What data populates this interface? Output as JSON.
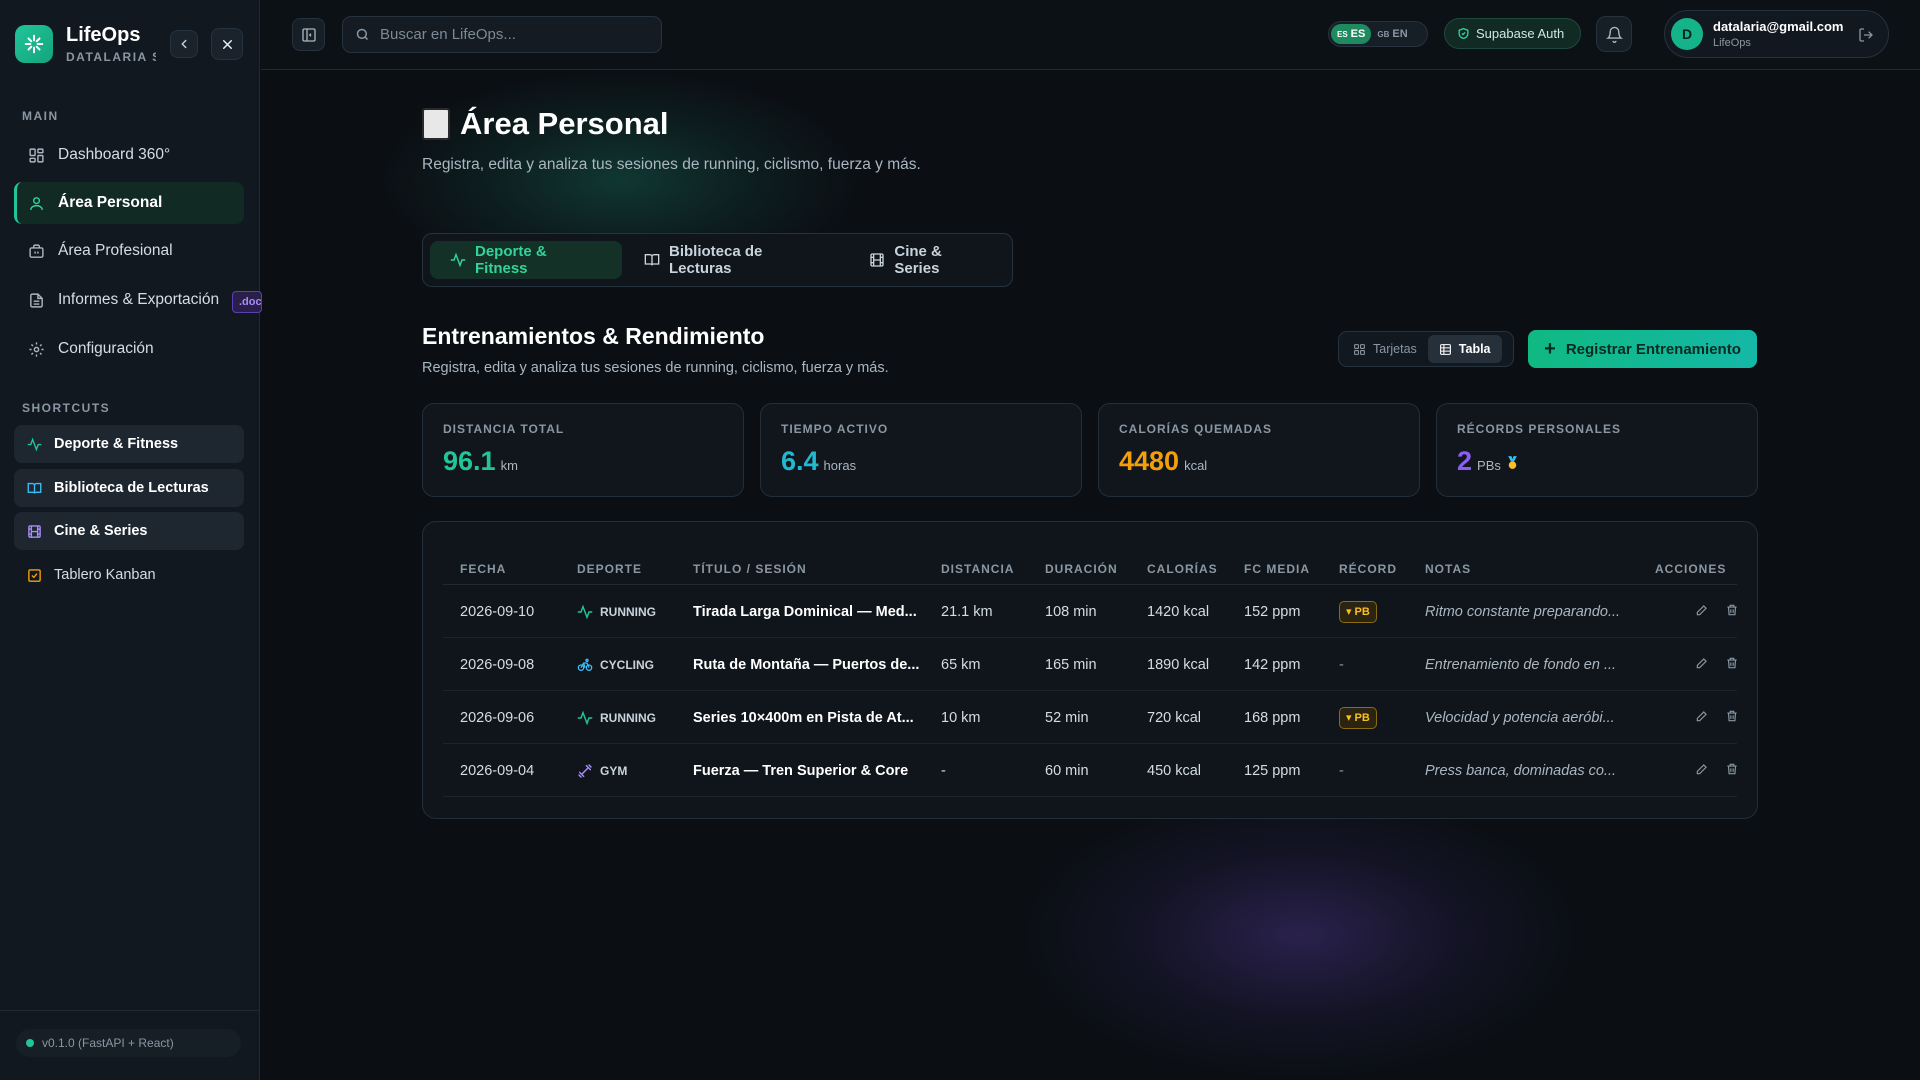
{
  "app": {
    "name": "LifeOps",
    "subtitle": "DATALARIA STUDIO"
  },
  "sidebar": {
    "main_label": "MAIN",
    "items": [
      {
        "label": "Dashboard 360°",
        "icon": "dashboard-icon"
      },
      {
        "label": "Área Personal",
        "icon": "user-icon",
        "active": true
      },
      {
        "label": "Área Profesional",
        "icon": "briefcase-icon"
      },
      {
        "label": "Informes & Exportación",
        "icon": "file-icon",
        "badge": ".docx"
      },
      {
        "label": "Configuración",
        "icon": "gear-icon"
      }
    ],
    "shortcuts_label": "SHORTCUTS",
    "shortcuts": [
      {
        "label": "Deporte & Fitness",
        "icon": "activity-icon"
      },
      {
        "label": "Biblioteca de Lecturas",
        "icon": "book-icon"
      },
      {
        "label": "Cine & Series",
        "icon": "film-icon"
      },
      {
        "label": "Tablero Kanban",
        "icon": "checkbox-icon"
      }
    ],
    "version": "v0.1.0 (FastAPI + React)"
  },
  "topbar": {
    "search_placeholder": "Buscar en LifeOps...",
    "lang_es_flag": "ES",
    "lang_es": "ES",
    "lang_en_flag": "GB",
    "lang_en": "EN",
    "auth_label": "Supabase Auth",
    "user_initial": "D",
    "user_email": "datalaria@gmail.com",
    "user_app": "LifeOps"
  },
  "page": {
    "title": "Área Personal",
    "subtitle": "Registra, edita y analiza tus sesiones de running, ciclismo, fuerza y más."
  },
  "tabs": [
    {
      "label": "Deporte & Fitness",
      "active": true
    },
    {
      "label": "Biblioteca de Lecturas"
    },
    {
      "label": "Cine & Series"
    }
  ],
  "section": {
    "title": "Entrenamientos & Rendimiento",
    "subtitle": "Registra, edita y analiza tus sesiones de running, ciclismo, fuerza y más.",
    "view_cards": "Tarjetas",
    "view_table": "Tabla",
    "add_button": "Registrar Entrenamiento"
  },
  "stats": [
    {
      "label": "DISTANCIA TOTAL",
      "value": "96.1",
      "unit": "km",
      "color": "#22c59a"
    },
    {
      "label": "TIEMPO ACTIVO",
      "value": "6.4",
      "unit": "horas",
      "color": "#22b8cf"
    },
    {
      "label": "CALORÍAS QUEMADAS",
      "value": "4480",
      "unit": "kcal",
      "color": "#f59e0b"
    },
    {
      "label": "RÉCORDS PERSONALES",
      "value": "2",
      "unit": "PBs",
      "color": "#8b5cf6"
    }
  ],
  "table": {
    "headers": [
      "FECHA",
      "DEPORTE",
      "TÍTULO / SESIÓN",
      "DISTANCIA",
      "DURACIÓN",
      "CALORÍAS",
      "FC MEDIA",
      "RÉCORD",
      "NOTAS",
      "ACCIONES"
    ],
    "rows": [
      {
        "date": "2026-09-10",
        "sport": "RUNNING",
        "title": "Tirada Larga Dominical — Med...",
        "distance": "21.1 km",
        "duration": "108 min",
        "calories": "1420 kcal",
        "hr": "152 ppm",
        "record": "PB",
        "notes": "Ritmo constante preparando..."
      },
      {
        "date": "2026-09-08",
        "sport": "CYCLING",
        "title": "Ruta de Montaña — Puertos de...",
        "distance": "65 km",
        "duration": "165 min",
        "calories": "1890 kcal",
        "hr": "142 ppm",
        "record": "-",
        "notes": "Entrenamiento de fondo en ..."
      },
      {
        "date": "2026-09-06",
        "sport": "RUNNING",
        "title": "Series 10×400m en Pista de At...",
        "distance": "10 km",
        "duration": "52 min",
        "calories": "720 kcal",
        "hr": "168 ppm",
        "record": "PB",
        "notes": "Velocidad y potencia aeróbi..."
      },
      {
        "date": "2026-09-04",
        "sport": "GYM",
        "title": "Fuerza — Tren Superior & Core",
        "distance": "-",
        "duration": "60 min",
        "calories": "450 kcal",
        "hr": "125 ppm",
        "record": "-",
        "notes": "Press banca, dominadas co..."
      }
    ]
  }
}
